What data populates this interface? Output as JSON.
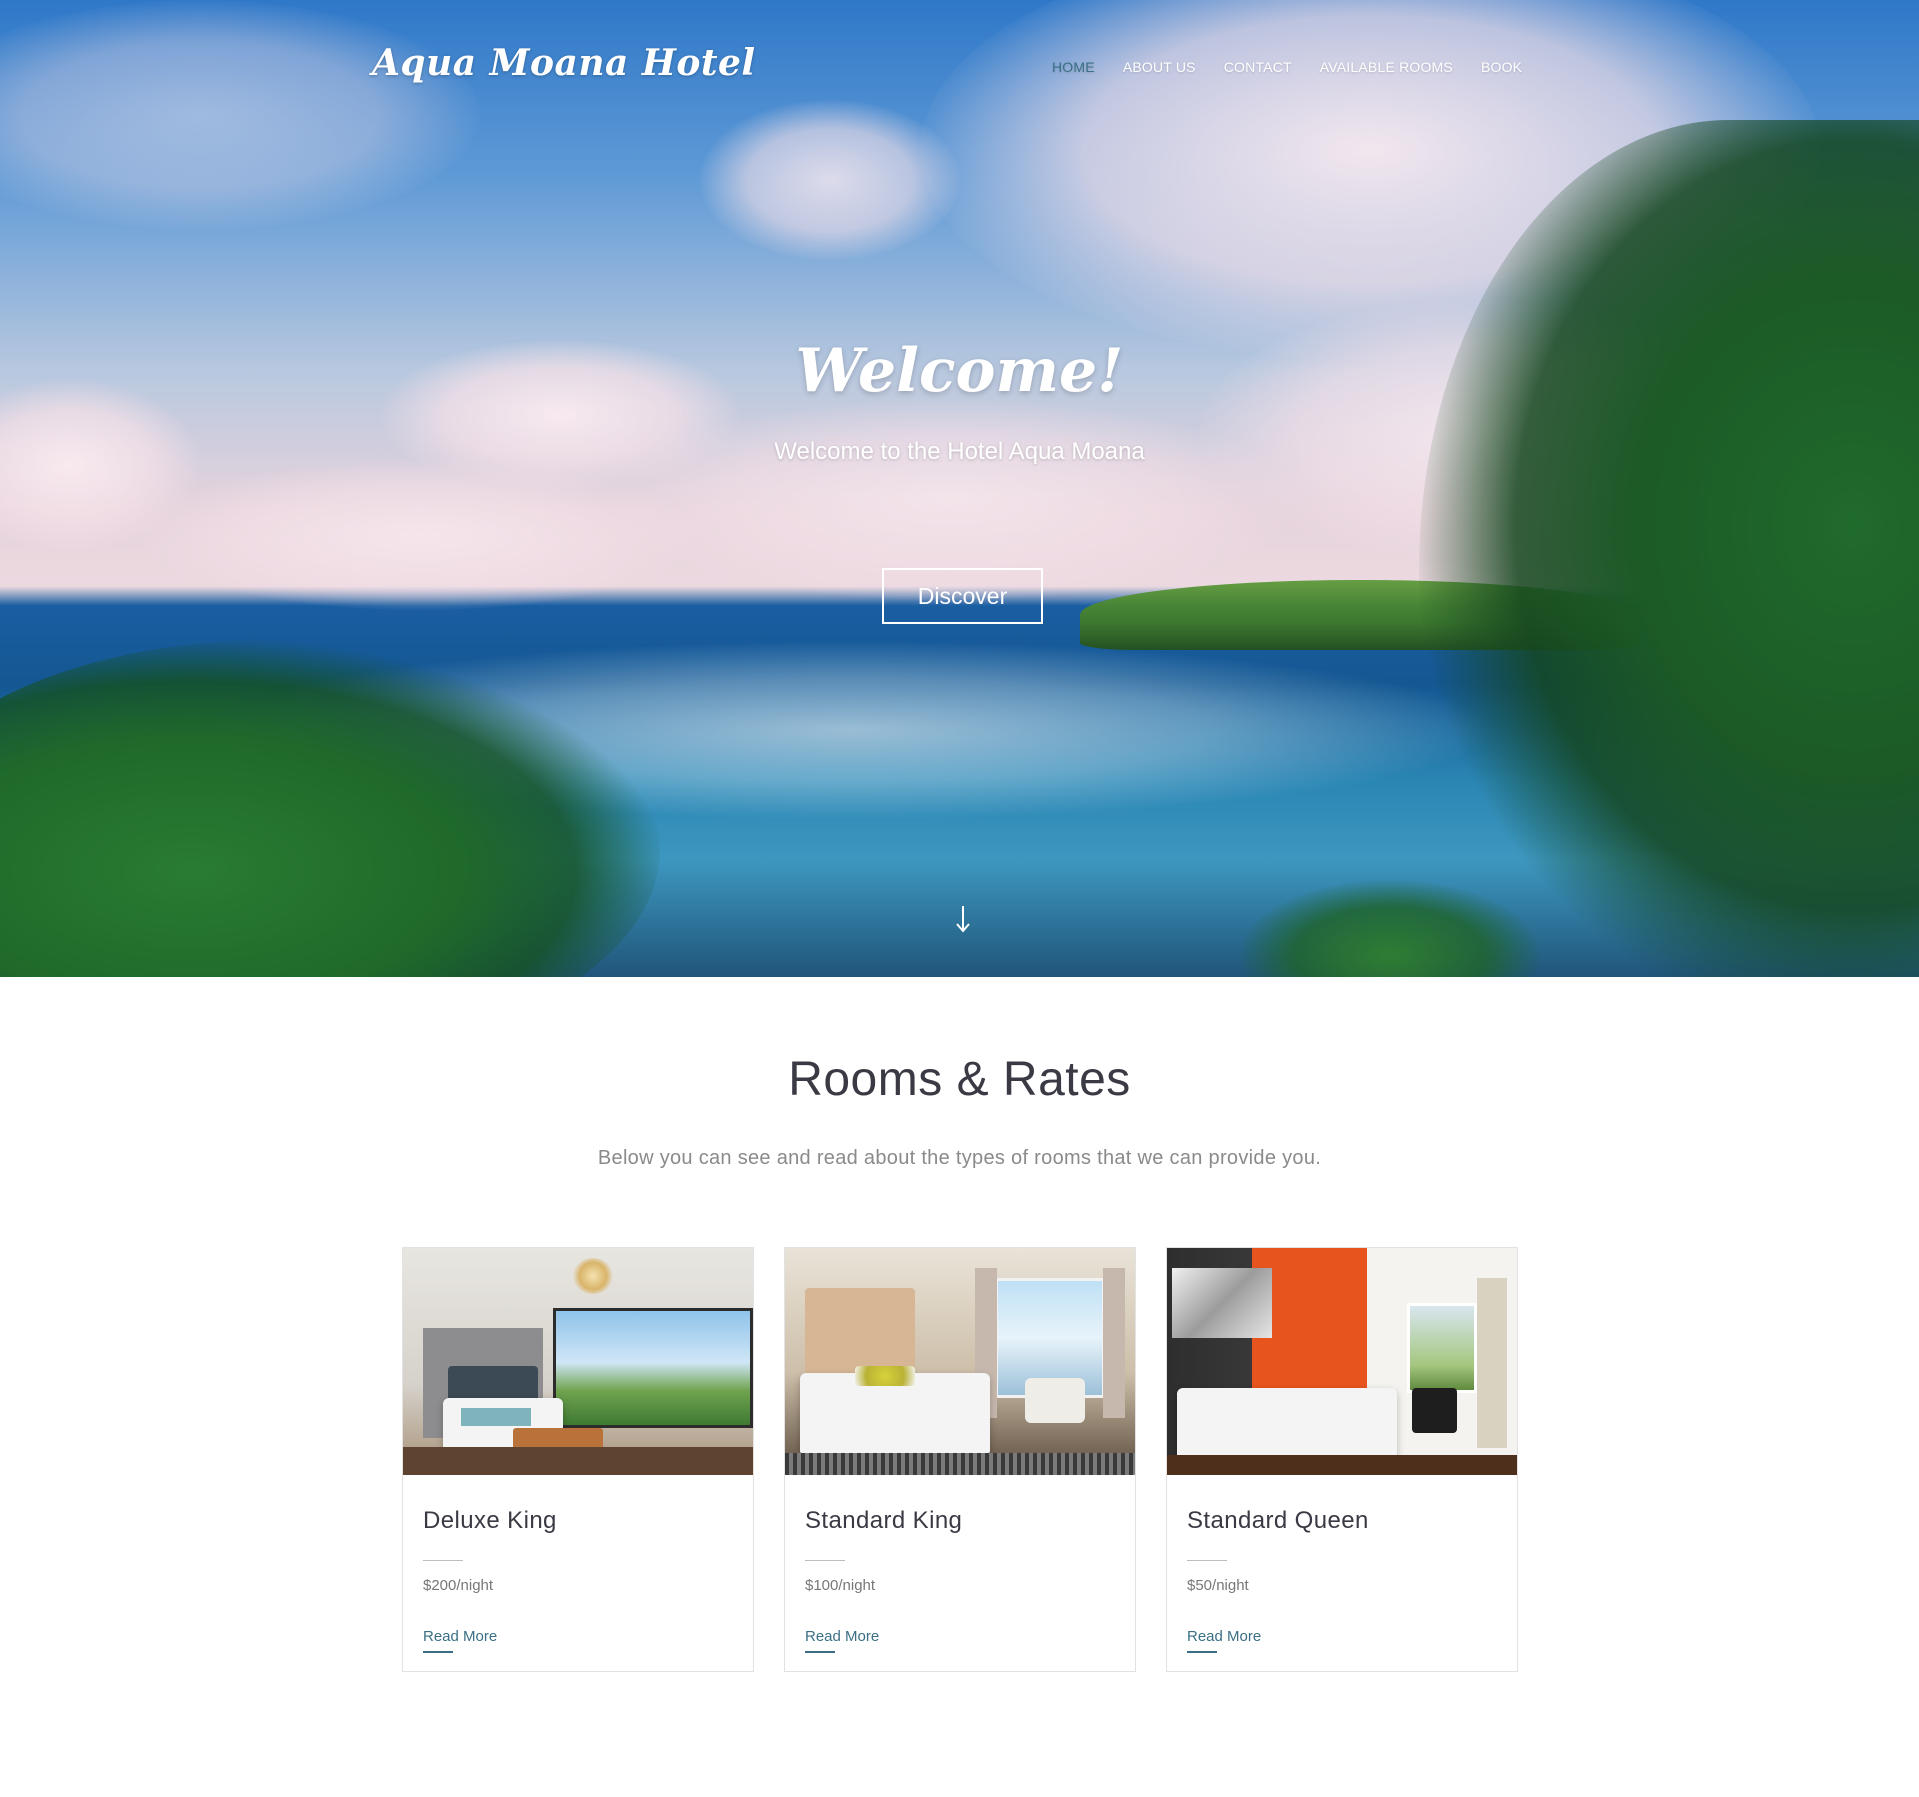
{
  "header": {
    "logo": "Aqua Moana Hotel",
    "nav": [
      {
        "label": "HOME",
        "active": true
      },
      {
        "label": "ABOUT US",
        "active": false
      },
      {
        "label": "CONTACT",
        "active": false
      },
      {
        "label": "AVAILABLE ROOMS",
        "active": false
      },
      {
        "label": "BOOK",
        "active": false
      }
    ]
  },
  "hero": {
    "title": "Welcome!",
    "subtitle": "Welcome to the Hotel Aqua Moana",
    "button_label": "Discover",
    "scroll_icon": "arrow-down-icon"
  },
  "rooms": {
    "title": "Rooms & Rates",
    "subtitle": "Below you can see and read about the types of rooms that we can provide you.",
    "items": [
      {
        "name": "Deluxe King",
        "price": "$200/night",
        "link_label": "Read More"
      },
      {
        "name": "Standard King",
        "price": "$100/night",
        "link_label": "Read More"
      },
      {
        "name": "Standard Queen",
        "price": "$50/night",
        "link_label": "Read More"
      }
    ]
  },
  "colors": {
    "accent": "#3b6f85",
    "heading": "#3a3a44",
    "muted": "#8a8a8a"
  }
}
